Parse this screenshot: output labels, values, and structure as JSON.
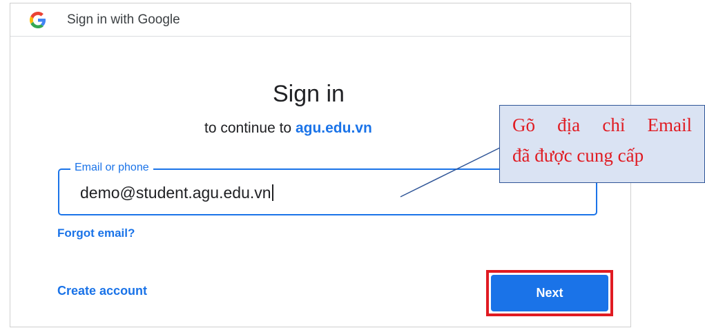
{
  "titlebar": {
    "logo_icon": "google-g-icon",
    "title": "Sign in with Google"
  },
  "main": {
    "heading": "Sign in",
    "subtitle_prefix": "to continue to",
    "subtitle_domain": "agu.edu.vn"
  },
  "email_field": {
    "label": "Email or phone",
    "value": "demo@student.agu.edu.vn"
  },
  "links": {
    "forgot_email": "Forgot email?",
    "create_account": "Create account"
  },
  "buttons": {
    "next": "Next"
  },
  "annotation": {
    "line1_words": [
      "Gõ",
      "địa",
      "chỉ",
      "Email"
    ],
    "line2": "đã được cung cấp"
  },
  "colors": {
    "accent": "#1a73e8",
    "highlight": "#e01b22",
    "callout_bg": "#dae3f3",
    "callout_border": "#2f5597"
  }
}
